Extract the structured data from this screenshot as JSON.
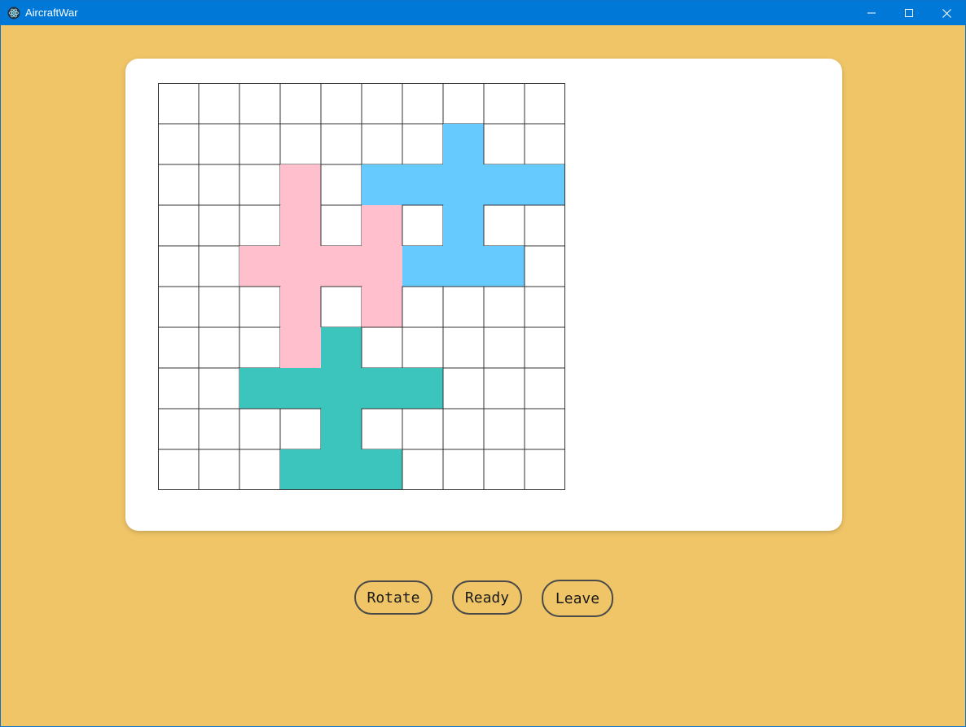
{
  "window": {
    "title": "AircraftWar",
    "icon": "electron-app-icon",
    "controls": [
      "minimize-icon",
      "maximize-icon",
      "close-icon"
    ]
  },
  "colors": {
    "background": "#efc567",
    "titlebar": "#0078d7",
    "card": "#ffffff",
    "grid_line": "#333333",
    "plane_pink": "#ffbfcd",
    "plane_blue": "#66caff",
    "plane_teal": "#3bc5bd"
  },
  "board": {
    "rows": 10,
    "cols": 10,
    "planes": [
      {
        "name": "pink",
        "color": "#ffbfcd",
        "cells": [
          [
            2,
            3
          ],
          [
            3,
            3
          ],
          [
            3,
            5
          ],
          [
            4,
            2
          ],
          [
            4,
            3
          ],
          [
            4,
            4
          ],
          [
            4,
            5
          ],
          [
            5,
            3
          ],
          [
            5,
            5
          ],
          [
            6,
            3
          ]
        ]
      },
      {
        "name": "blue",
        "color": "#66caff",
        "cells": [
          [
            1,
            7
          ],
          [
            2,
            5
          ],
          [
            2,
            6
          ],
          [
            2,
            7
          ],
          [
            2,
            8
          ],
          [
            2,
            9
          ],
          [
            3,
            7
          ],
          [
            4,
            6
          ],
          [
            4,
            7
          ],
          [
            4,
            8
          ]
        ]
      },
      {
        "name": "teal",
        "color": "#3bc5bd",
        "cells": [
          [
            6,
            4
          ],
          [
            7,
            2
          ],
          [
            7,
            3
          ],
          [
            7,
            4
          ],
          [
            7,
            5
          ],
          [
            7,
            6
          ],
          [
            8,
            4
          ],
          [
            9,
            3
          ],
          [
            9,
            4
          ],
          [
            9,
            5
          ]
        ]
      }
    ]
  },
  "actions": {
    "rotate_label": "Rotate",
    "ready_label": "Ready",
    "leave_label": "Leave"
  }
}
